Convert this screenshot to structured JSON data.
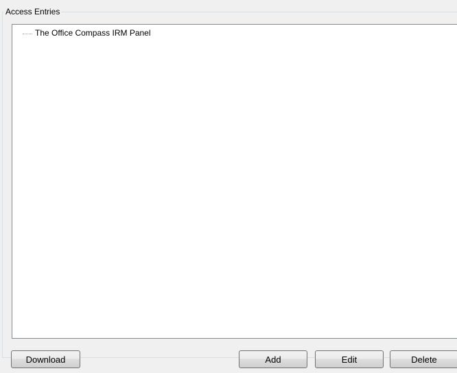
{
  "access_entries": {
    "group_title": "Access Entries",
    "tree_items": [
      {
        "label": "The Office Compass IRM Panel"
      }
    ]
  },
  "buttons": {
    "download_label": "Download",
    "add_label": "Add",
    "edit_label": "Edit",
    "delete_label": "Delete"
  }
}
